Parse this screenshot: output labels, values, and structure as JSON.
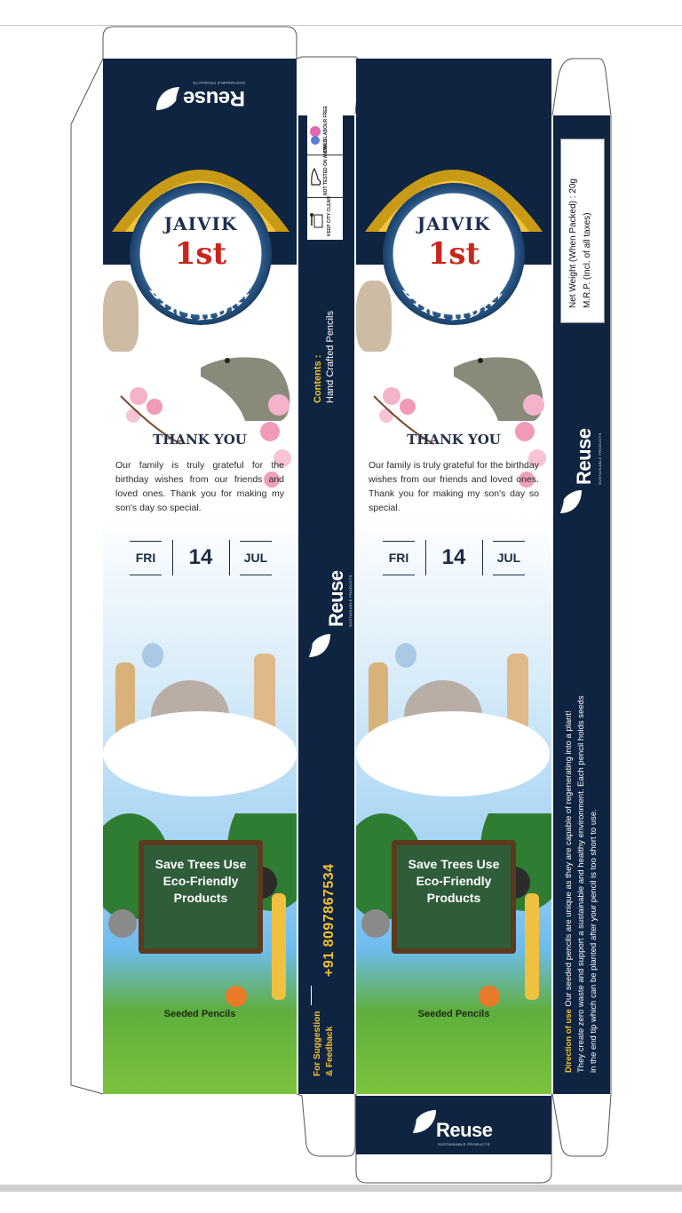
{
  "card": {
    "name_line": "JAIVIK",
    "ordinal": "1st",
    "occasion": "BIRTHDAY",
    "thank_heading": "THANK YOU",
    "message": "Our family is truly grateful for the birthday wishes from our friends and loved ones. Thank you for making my son's day so special.",
    "date": {
      "day_name": "FRI",
      "day_num": "14",
      "month": "JUL"
    },
    "board_text": "Save Trees Use Eco-Friendly Products",
    "product_label": "Seeded Pencils"
  },
  "brand": {
    "name": "Reuse",
    "tagline": "SUSTAINABLE PRODUCTS"
  },
  "spine": {
    "contents_label": "Contents :",
    "contents_value": "Hand Crafted Pencils",
    "phone": "+91 8097867534",
    "feedback_line1": "For Suggestion",
    "feedback_line2": "& Feedback",
    "icons": [
      {
        "icon": "hand-icon",
        "label": "CHILD LABOUR FREE"
      },
      {
        "icon": "rabbit-icon",
        "label": "NOT TESTED ON ANIMALS"
      },
      {
        "icon": "bin-icon",
        "label": "KEEP CITY CLEAN"
      }
    ]
  },
  "back": {
    "net_weight": "Net Weight (When Packed) : 20g",
    "mrp": "M.R.P. (Incl. of all taxes)",
    "direction_label": "Direction of use",
    "direction_text_1": "Our seeded pencils are unique as they are capable of regenerating into a plant!",
    "direction_text_2": "They create zero waste and support a sustainable and healthy environment. Each pencil holds seeds",
    "direction_text_3": "in the end tip which can be planted after your pencil is too short to use."
  },
  "colors": {
    "navy": "#0f2440",
    "accent_red": "#c8261d",
    "gold": "#d4a520",
    "yellow_text": "#f2c230",
    "grass": "#7cc23d"
  }
}
